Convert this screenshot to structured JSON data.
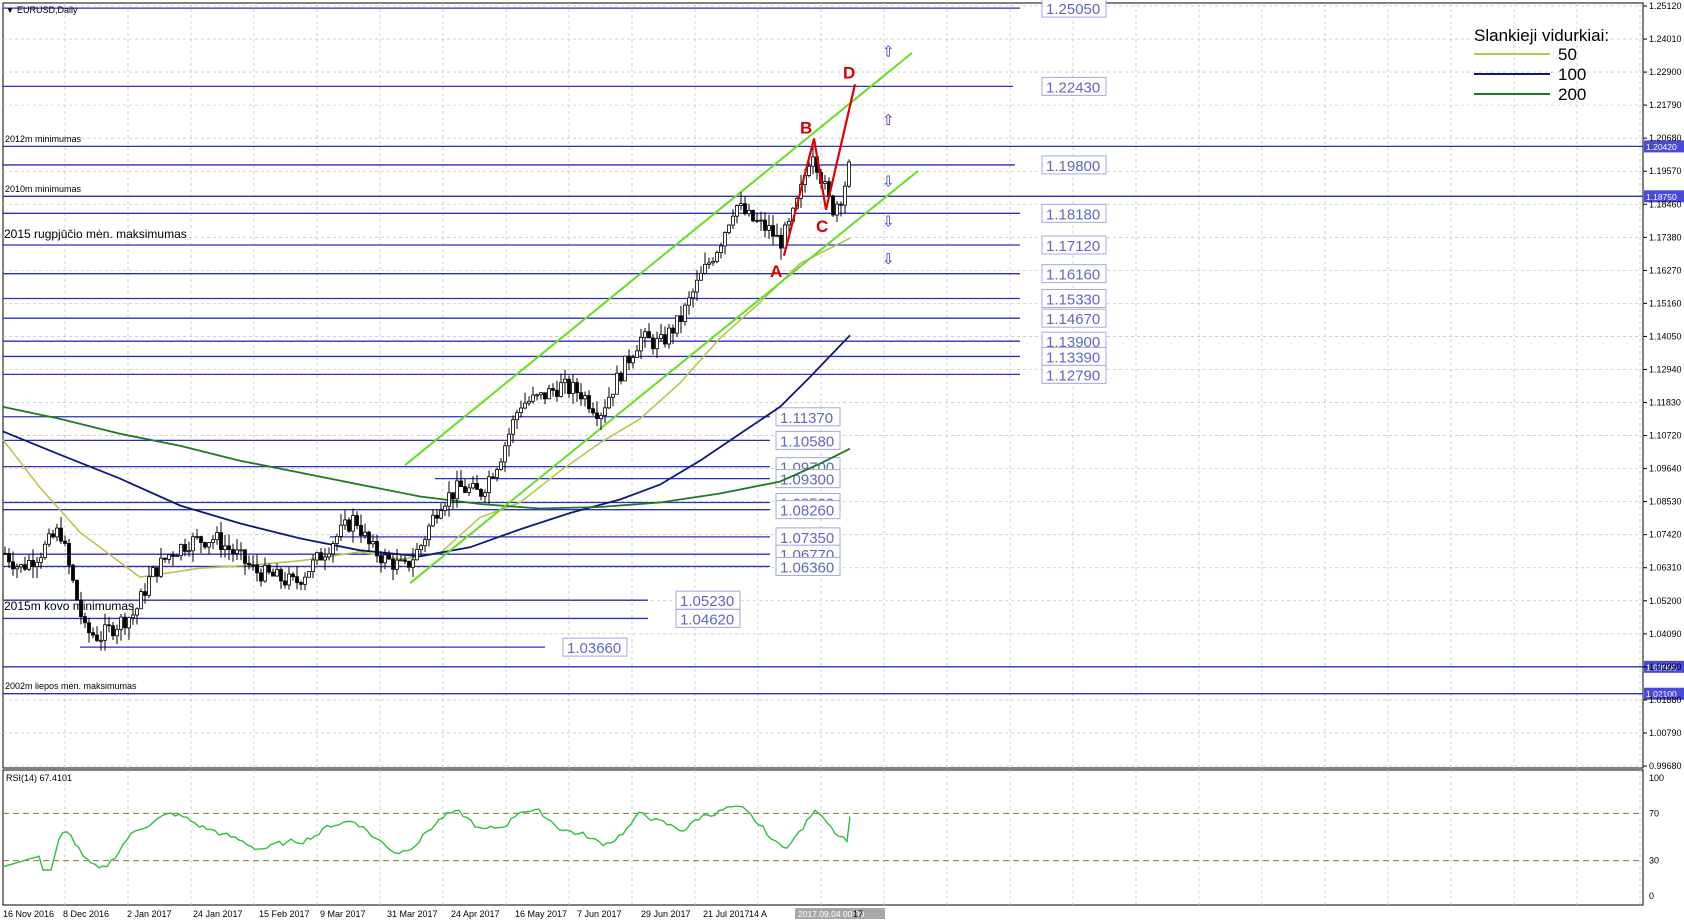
{
  "window": {
    "title": "EURUSD,Daily"
  },
  "colors": {
    "level_line": "#2a2fbf",
    "channel": "#66dd22",
    "ma50": "#b2c94a",
    "ma100": "#0b1a7a",
    "ma200": "#1e7a1e",
    "candles": "#000000",
    "rsi": "#2fbf3f",
    "rsi_level": "#8a7a2a",
    "abcd": "#e00000"
  },
  "legend": {
    "title": "Slankieji vidurkiai:",
    "items": [
      {
        "label": "50",
        "color": "#b2c94a"
      },
      {
        "label": "100",
        "color": "#0b1a7a"
      },
      {
        "label": "200",
        "color": "#1e7a1e"
      }
    ]
  },
  "annotations": {
    "min_2012": "2012m minimumas",
    "min_2010": "2010m minimumas",
    "max_2015_aug": "2015 rugpjūčio mėn. maksimumas",
    "min_2015_mar": "2015m kovo minimumas",
    "max_2002_jul": "2002m liepos mėn. maksimumas"
  },
  "pattern_labels": [
    "A",
    "B",
    "C",
    "D"
  ],
  "arrows": {
    "up": "⇧",
    "down": "⇩"
  },
  "chart_data": {
    "type": "candlestick",
    "symbol": "EURUSD",
    "timeframe": "Daily",
    "ylim": [
      0.9968,
      1.2512
    ],
    "y_ticks": [
      "1.25120",
      "1.24010",
      "1.22900",
      "1.21790",
      "1.20680",
      "1.19570",
      "1.18460",
      "1.17380",
      "1.16270",
      "1.15160",
      "1.14050",
      "1.12940",
      "1.11830",
      "1.10720",
      "1.09640",
      "1.08530",
      "1.07420",
      "1.06310",
      "1.05200",
      "1.04090",
      "1.02990",
      "1.01880",
      "1.00790",
      "0.99680"
    ],
    "x_ticks": [
      "16 Nov 2016",
      "8 Dec 2016",
      "2 Jan 2017",
      "24 Jan 2017",
      "15 Feb 2017",
      "9 Mar 2017",
      "31 Mar 2017",
      "24 Apr 2017",
      "16 May 2017",
      "7 Jun 2017",
      "29 Jun 2017",
      "21 Jul 2017",
      "14 A",
      "2017.09.04 00:00",
      "17"
    ],
    "price_tags": [
      "1.20420",
      "1.18750",
      "1.03000",
      "1.02100"
    ],
    "levels": [
      {
        "value": 1.2505,
        "label": "1.25050"
      },
      {
        "value": 1.2243,
        "label": "1.22430"
      },
      {
        "value": 1.198,
        "label": "1.19800"
      },
      {
        "value": 1.1818,
        "label": "1.18180"
      },
      {
        "value": 1.1712,
        "label": "1.17120"
      },
      {
        "value": 1.1616,
        "label": "1.16160"
      },
      {
        "value": 1.1533,
        "label": "1.15330"
      },
      {
        "value": 1.1467,
        "label": "1.14670"
      },
      {
        "value": 1.139,
        "label": "1.13900"
      },
      {
        "value": 1.1339,
        "label": "1.13390"
      },
      {
        "value": 1.1279,
        "label": "1.12790"
      },
      {
        "value": 1.1137,
        "label": "1.11370"
      },
      {
        "value": 1.1058,
        "label": "1.10580"
      },
      {
        "value": 1.097,
        "label": "1.09700"
      },
      {
        "value": 1.093,
        "label": "1.09300"
      },
      {
        "value": 1.085,
        "label": "1.08500"
      },
      {
        "value": 1.0826,
        "label": "1.08260"
      },
      {
        "value": 1.0735,
        "label": "1.07350"
      },
      {
        "value": 1.0677,
        "label": "1.06770"
      },
      {
        "value": 1.0636,
        "label": "1.06360"
      },
      {
        "value": 1.0523,
        "label": "1.05230"
      },
      {
        "value": 1.0462,
        "label": "1.04620"
      },
      {
        "value": 1.0366,
        "label": "1.03660"
      }
    ],
    "key_levels": [
      {
        "value": 1.2042,
        "label": "2012m minimumas"
      },
      {
        "value": 1.1875,
        "label": "2010m minimumas"
      },
      {
        "value": 1.03,
        "label": "2002m liepos mėn. maksimumas"
      },
      {
        "value": 1.021,
        "label": ""
      }
    ],
    "abcd": [
      {
        "label": "A",
        "price": 1.1662
      },
      {
        "label": "B",
        "price": 1.207
      },
      {
        "label": "C",
        "price": 1.1823
      },
      {
        "label": "D",
        "price": 1.225
      }
    ],
    "rsi": {
      "label": "RSI(14) 67.4101",
      "period": 14,
      "value": 67.4101,
      "levels": [
        30,
        70
      ],
      "ticks": [
        "100",
        "70",
        "30",
        "0"
      ],
      "ylim": [
        0,
        100
      ]
    }
  }
}
